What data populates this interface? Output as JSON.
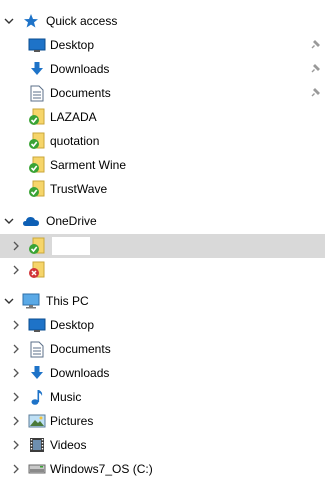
{
  "quick_access": {
    "label": "Quick access",
    "items": [
      {
        "label": "Desktop",
        "icon": "desktop-icon",
        "pinned": true
      },
      {
        "label": "Downloads",
        "icon": "downloads-icon",
        "pinned": true
      },
      {
        "label": "Documents",
        "icon": "documents-icon",
        "pinned": true
      },
      {
        "label": "LAZADA",
        "icon": "synced-folder-icon"
      },
      {
        "label": "quotation",
        "icon": "synced-folder-icon"
      },
      {
        "label": "Sarment Wine",
        "icon": "synced-folder-icon"
      },
      {
        "label": "TrustWave",
        "icon": "synced-folder-icon"
      }
    ]
  },
  "onedrive": {
    "label": "OneDrive",
    "items": [
      {
        "label": "",
        "icon": "synced-folder-icon",
        "selected": true
      },
      {
        "label": "",
        "icon": "sync-error-folder-icon"
      }
    ]
  },
  "this_pc": {
    "label": "This PC",
    "items": [
      {
        "label": "Desktop",
        "icon": "desktop-icon"
      },
      {
        "label": "Documents",
        "icon": "documents-icon"
      },
      {
        "label": "Downloads",
        "icon": "downloads-icon"
      },
      {
        "label": "Music",
        "icon": "music-icon"
      },
      {
        "label": "Pictures",
        "icon": "pictures-icon"
      },
      {
        "label": "Videos",
        "icon": "videos-icon"
      },
      {
        "label": "Windows7_OS (C:)",
        "icon": "drive-icon"
      }
    ]
  },
  "colors": {
    "accent": "#1e73c8",
    "selection": "#d9d9d9",
    "sync_ok": "#3aa335",
    "sync_error": "#d13438"
  }
}
